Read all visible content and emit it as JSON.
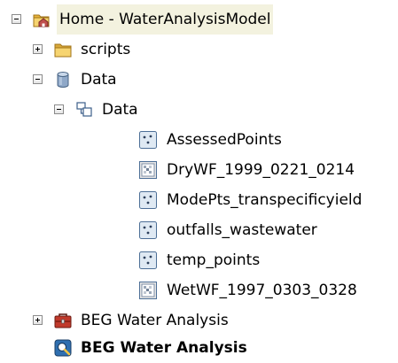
{
  "tree": {
    "home": {
      "label": "Home - WaterAnalysisModel",
      "icon": "home-folder-icon",
      "expanded": true
    },
    "scripts": {
      "label": "scripts",
      "icon": "folder-icon",
      "expanded": false
    },
    "data_gdb": {
      "label": "Data",
      "icon": "geodatabase-icon",
      "expanded": true
    },
    "data_dataset": {
      "label": "Data",
      "icon": "feature-dataset-icon",
      "expanded": true
    },
    "items": [
      {
        "label": "AssessedPoints",
        "icon": "point-feature-class-icon"
      },
      {
        "label": "DryWF_1999_0221_0214",
        "icon": "raster-icon"
      },
      {
        "label": "ModePts_transpecificyield",
        "icon": "point-feature-class-icon"
      },
      {
        "label": "outfalls_wastewater",
        "icon": "point-feature-class-icon"
      },
      {
        "label": "temp_points",
        "icon": "point-feature-class-icon"
      },
      {
        "label": "WetWF_1997_0303_0328",
        "icon": "raster-icon"
      }
    ],
    "toolbox": {
      "label": "BEG Water Analysis",
      "icon": "toolbox-icon",
      "expanded": false
    },
    "model": {
      "label": "BEG Water Analysis",
      "icon": "model-icon"
    }
  },
  "colors": {
    "highlight": "#f3f2df",
    "folder": "#f2c94c"
  }
}
